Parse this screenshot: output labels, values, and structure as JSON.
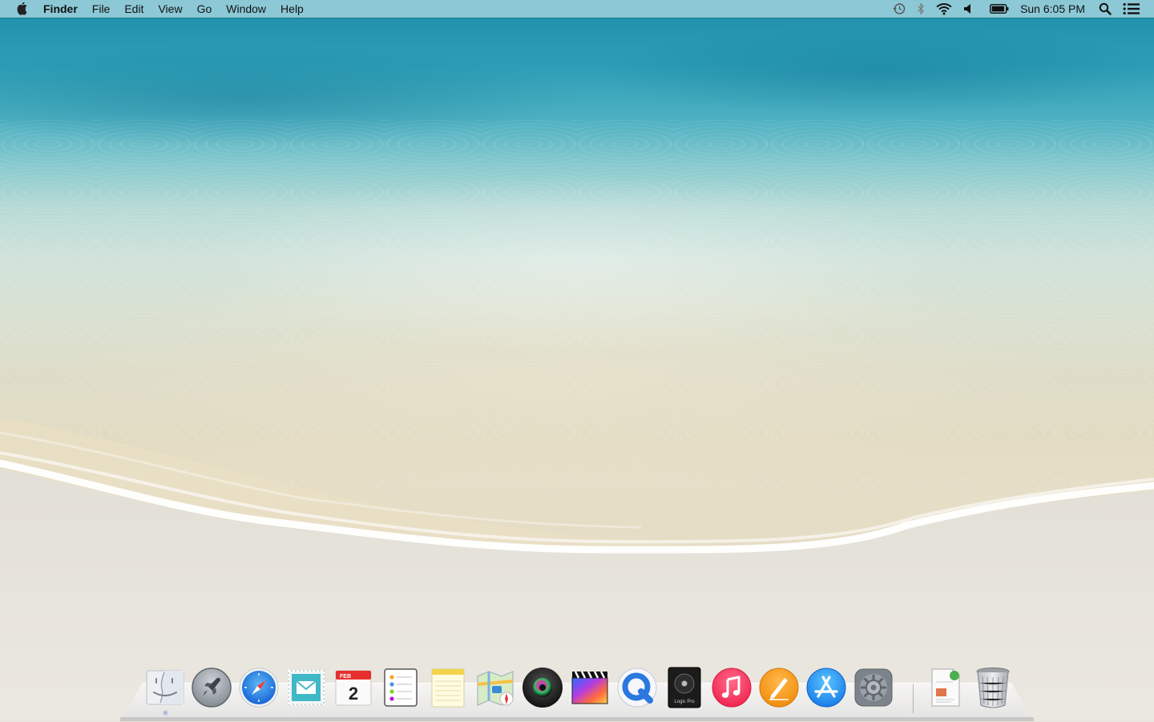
{
  "menubar": {
    "apple_icon": "apple-logo-icon",
    "app_name": "Finder",
    "menus": [
      "File",
      "Edit",
      "View",
      "Go",
      "Window",
      "Help"
    ],
    "status_icons": [
      "time-machine-icon",
      "bluetooth-icon",
      "wifi-icon",
      "volume-icon",
      "battery-icon"
    ],
    "clock": "Sun 6:05 PM",
    "right_icons": [
      "spotlight-search-icon",
      "notification-center-icon"
    ]
  },
  "dock": {
    "apps": [
      {
        "name": "Finder",
        "icon": "finder-icon"
      },
      {
        "name": "Launchpad",
        "icon": "launchpad-icon"
      },
      {
        "name": "Safari",
        "icon": "safari-icon"
      },
      {
        "name": "Mail",
        "icon": "mail-icon"
      },
      {
        "name": "Calendar",
        "icon": "calendar-icon",
        "month": "FEB",
        "day": "2"
      },
      {
        "name": "Reminders",
        "icon": "reminders-icon"
      },
      {
        "name": "Notes",
        "icon": "notes-icon"
      },
      {
        "name": "Maps",
        "icon": "maps-icon"
      },
      {
        "name": "Photo Booth",
        "icon": "photo-booth-icon"
      },
      {
        "name": "Final Cut Pro",
        "icon": "final-cut-pro-icon"
      },
      {
        "name": "QuickTime Player",
        "icon": "quicktime-icon"
      },
      {
        "name": "Logic Pro",
        "icon": "logic-pro-icon",
        "label": "Logic Pro"
      },
      {
        "name": "iTunes",
        "icon": "itunes-icon"
      },
      {
        "name": "Pages",
        "icon": "pages-icon"
      },
      {
        "name": "App Store",
        "icon": "app-store-icon"
      },
      {
        "name": "System Preferences",
        "icon": "system-preferences-icon"
      }
    ],
    "stacks": [
      {
        "name": "Documents",
        "icon": "documents-stack-icon"
      },
      {
        "name": "Trash",
        "icon": "trash-icon"
      }
    ]
  },
  "colors": {
    "menubar": "#aad7e1",
    "sea_deep": "#1f8fa8",
    "sand": "#e6ddc6"
  }
}
